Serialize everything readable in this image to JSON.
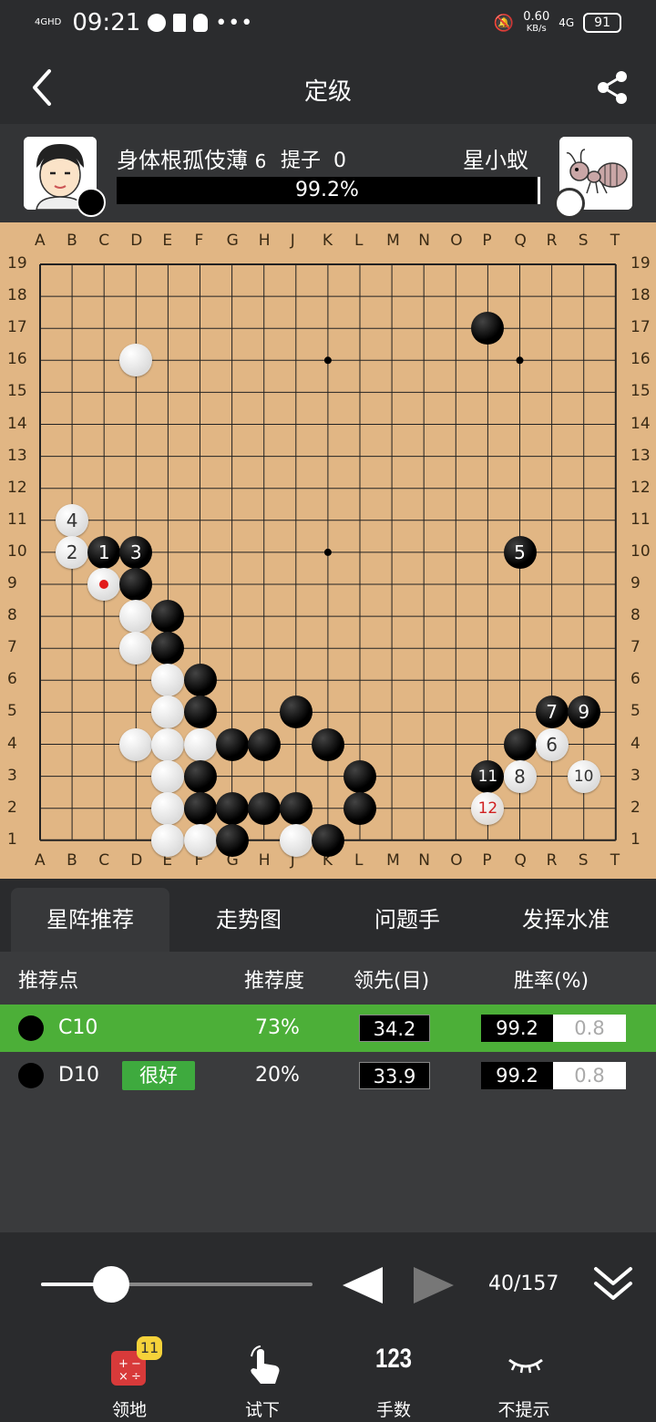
{
  "status_bar": {
    "network": "4GHD",
    "time": "09:21",
    "speed_value": "0.60",
    "speed_unit": "KB/s",
    "signal_right": "4G",
    "battery": "91"
  },
  "header": {
    "title": "定级"
  },
  "players": {
    "black_name": "身体根孤伎薄",
    "black_level": "6",
    "captures_label": "提子",
    "captures": "0",
    "white_name": "星小蚁",
    "win_rate_text": "99.2%",
    "win_rate_fraction": 0.992
  },
  "board": {
    "columns": [
      "A",
      "B",
      "C",
      "D",
      "E",
      "F",
      "G",
      "H",
      "J",
      "K",
      "L",
      "M",
      "N",
      "O",
      "P",
      "Q",
      "R",
      "S",
      "T"
    ],
    "rows": [
      "19",
      "18",
      "17",
      "16",
      "15",
      "14",
      "13",
      "12",
      "11",
      "10",
      "9",
      "8",
      "7",
      "6",
      "5",
      "4",
      "3",
      "2",
      "1"
    ],
    "star_points": [
      "K16",
      "Q16",
      "K10"
    ],
    "last_move": "C9",
    "stones": [
      {
        "color": "black",
        "pos": "P17"
      },
      {
        "color": "white",
        "pos": "D16"
      },
      {
        "color": "white",
        "pos": "B11",
        "label": "4"
      },
      {
        "color": "white",
        "pos": "B10",
        "label": "2"
      },
      {
        "color": "black",
        "pos": "C10",
        "label": "1"
      },
      {
        "color": "black",
        "pos": "D10",
        "label": "3"
      },
      {
        "color": "black",
        "pos": "Q10",
        "label": "5"
      },
      {
        "color": "white",
        "pos": "C9"
      },
      {
        "color": "black",
        "pos": "D9"
      },
      {
        "color": "white",
        "pos": "D8"
      },
      {
        "color": "black",
        "pos": "E8"
      },
      {
        "color": "white",
        "pos": "D7"
      },
      {
        "color": "black",
        "pos": "E7"
      },
      {
        "color": "white",
        "pos": "E6"
      },
      {
        "color": "black",
        "pos": "F6"
      },
      {
        "color": "white",
        "pos": "E5"
      },
      {
        "color": "black",
        "pos": "F5"
      },
      {
        "color": "black",
        "pos": "J5"
      },
      {
        "color": "black",
        "pos": "R5",
        "label": "7"
      },
      {
        "color": "black",
        "pos": "S5",
        "label": "9"
      },
      {
        "color": "white",
        "pos": "D4"
      },
      {
        "color": "white",
        "pos": "E4"
      },
      {
        "color": "white",
        "pos": "F4"
      },
      {
        "color": "black",
        "pos": "G4"
      },
      {
        "color": "black",
        "pos": "H4"
      },
      {
        "color": "black",
        "pos": "K4"
      },
      {
        "color": "black",
        "pos": "Q4"
      },
      {
        "color": "white",
        "pos": "R4",
        "label": "6"
      },
      {
        "color": "white",
        "pos": "E3"
      },
      {
        "color": "black",
        "pos": "F3"
      },
      {
        "color": "black",
        "pos": "L3"
      },
      {
        "color": "black",
        "pos": "P3",
        "label": "11"
      },
      {
        "color": "white",
        "pos": "Q3",
        "label": "8"
      },
      {
        "color": "white",
        "pos": "S3",
        "label": "10"
      },
      {
        "color": "white",
        "pos": "E2"
      },
      {
        "color": "black",
        "pos": "F2"
      },
      {
        "color": "black",
        "pos": "G2"
      },
      {
        "color": "black",
        "pos": "H2"
      },
      {
        "color": "black",
        "pos": "J2"
      },
      {
        "color": "black",
        "pos": "L2"
      },
      {
        "color": "hint",
        "pos": "P2",
        "label": "12"
      },
      {
        "color": "white",
        "pos": "E1"
      },
      {
        "color": "white",
        "pos": "F1"
      },
      {
        "color": "black",
        "pos": "G1"
      },
      {
        "color": "white",
        "pos": "J1"
      },
      {
        "color": "black",
        "pos": "K1"
      }
    ]
  },
  "tabs": [
    "星阵推荐",
    "走势图",
    "问题手",
    "发挥水准"
  ],
  "table": {
    "headers": [
      "推荐点",
      "推荐度",
      "领先(目)",
      "胜率(%)"
    ],
    "rows": [
      {
        "point": "C10",
        "badge": "",
        "rec": "73%",
        "lead": "34.2",
        "win_black": "99.2",
        "win_white": "0.8",
        "highlight": "#4caf38"
      },
      {
        "point": "D10",
        "badge": "很好",
        "rec": "20%",
        "lead": "33.9",
        "win_black": "99.2",
        "win_white": "0.8",
        "highlight": ""
      }
    ]
  },
  "controls": {
    "move_counter": "40/157",
    "slider_fraction": 0.26
  },
  "bottom_nav": {
    "territory_label": "领地",
    "territory_badge": "11",
    "try_label": "试下",
    "moves_icon_text": "123",
    "moves_label": "手数",
    "nohint_label": "不提示"
  }
}
